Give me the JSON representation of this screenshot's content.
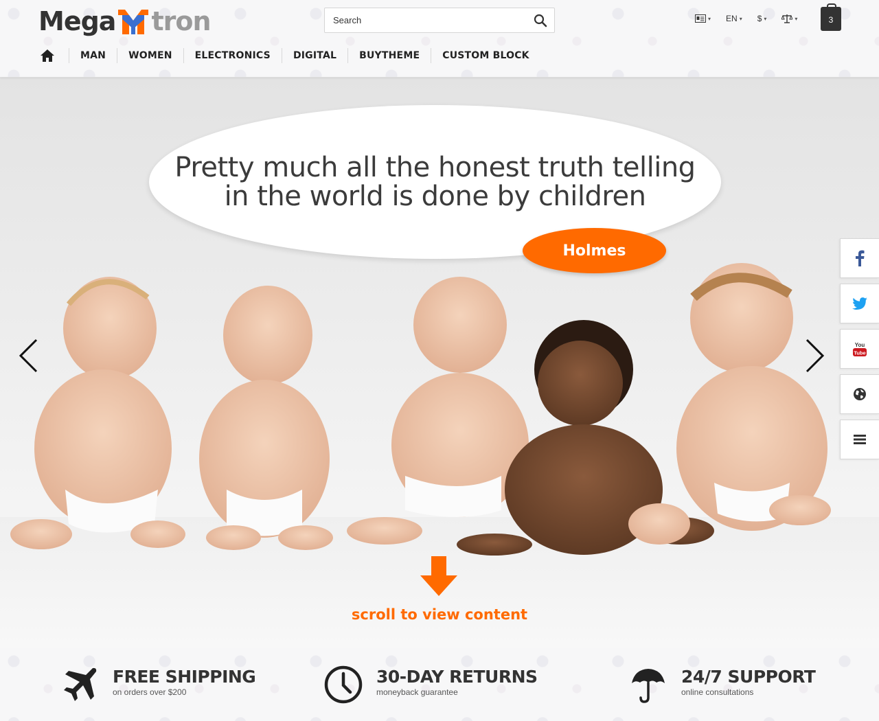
{
  "logo": {
    "part1": "Mega",
    "part2": "tron"
  },
  "search": {
    "placeholder": "Search",
    "value": ""
  },
  "top_tools": {
    "lang": "EN",
    "currency": "$",
    "cart_count": "3"
  },
  "nav": {
    "items": [
      "MAN",
      "WOMEN",
      "ELECTRONICS",
      "DIGITAL",
      "BUYTHEME",
      "CUSTOM BLOCK"
    ]
  },
  "hero": {
    "quote_line1": "Pretty much all the honest truth telling",
    "quote_line2": "in the world is done by children",
    "author": "Holmes",
    "scroll_text": "scroll to view content"
  },
  "social": {
    "icons": [
      "facebook-icon",
      "twitter-icon",
      "youtube-icon",
      "globe-icon",
      "menu-icon"
    ],
    "youtube_text": "You Tube"
  },
  "features": [
    {
      "title": "FREE SHIPPING",
      "subtitle": "on orders over $200",
      "icon": "airplane-icon"
    },
    {
      "title": "30-DAY RETURNS",
      "subtitle": "moneyback guarantee",
      "icon": "clock-icon"
    },
    {
      "title": "24/7 SUPPORT",
      "subtitle": "online consultations",
      "icon": "umbrella-icon"
    }
  ],
  "colors": {
    "accent": "#ff6a00",
    "dark": "#333333",
    "facebook": "#3b5998",
    "twitter": "#1da1f2",
    "youtube": "#cc181e"
  }
}
